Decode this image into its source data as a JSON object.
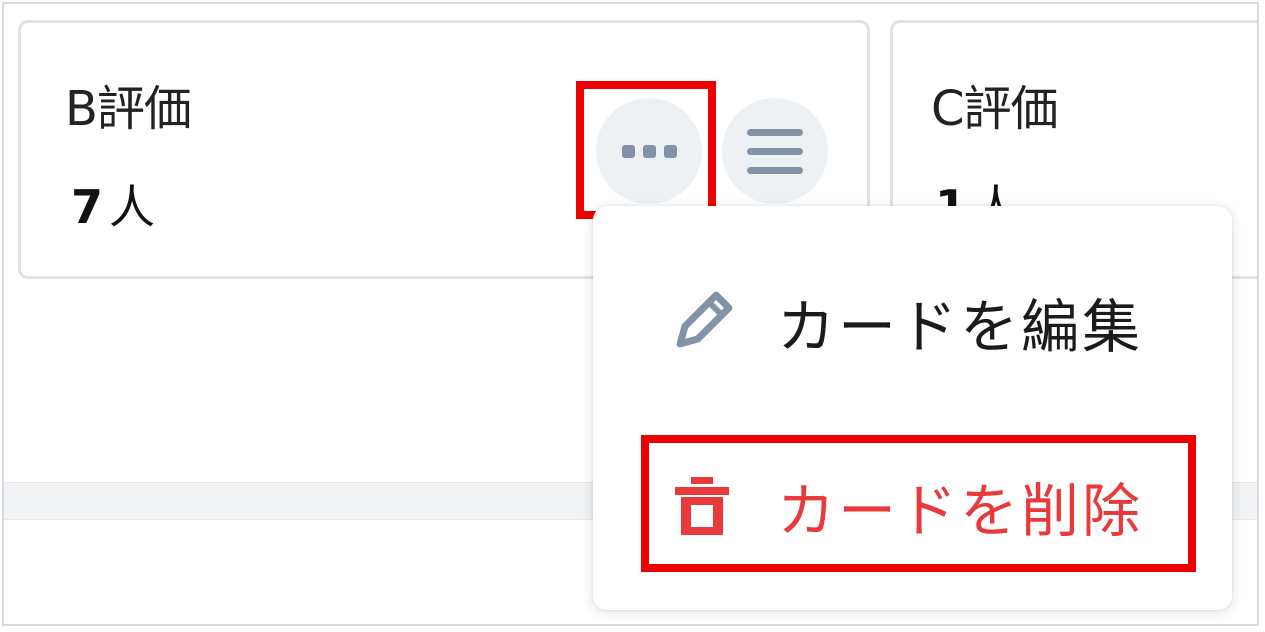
{
  "cards": [
    {
      "title": "B評価",
      "count": "7",
      "unit": "人"
    },
    {
      "title": "C評価",
      "count": "1",
      "unit": "人"
    }
  ],
  "card_actions": {
    "more_icon": "more-horizontal-icon",
    "list_icon": "menu-lines-icon"
  },
  "menu": {
    "items": [
      {
        "label": "カードを編集",
        "icon": "pencil-icon",
        "color": "#1b1b1b"
      },
      {
        "label": "カードを削除",
        "icon": "trash-icon",
        "color": "#e83a3a"
      }
    ]
  },
  "colors": {
    "highlight": "#ee0000",
    "icon_gray": "#8393a7",
    "danger": "#e83a3a"
  }
}
